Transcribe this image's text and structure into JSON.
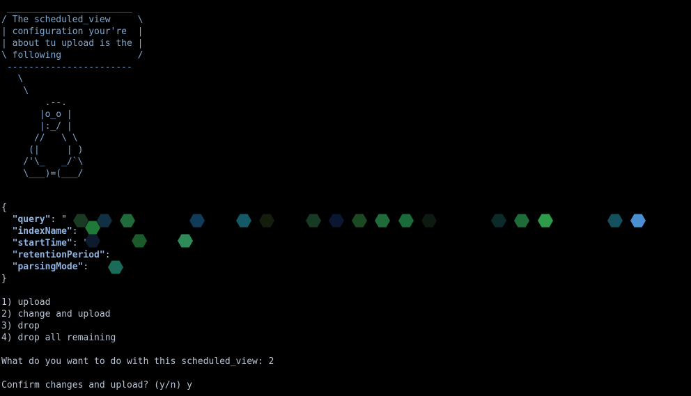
{
  "terminal": {
    "cowsay_bubble": [
      " _______________________",
      "/ The scheduled_view     \\",
      "| configuration your're  |",
      "| about tu upload is the |",
      "\\ following              /",
      " -----------------------"
    ],
    "tux_art": [
      "   \\",
      "    \\",
      "        .--.",
      "       |o_o |",
      "       |:_/ |",
      "      //   \\ \\",
      "     (|     | )",
      "    /'\\_   _/`\\",
      "    \\___)=(___/"
    ],
    "json_block": {
      "open_brace": "{",
      "close_brace": "}",
      "fields": [
        {
          "key": "\"query\"",
          "sep": ": ",
          "value": "\""
        },
        {
          "key": "\"indexName\"",
          "sep": ":",
          "value": ""
        },
        {
          "key": "\"startTime\"",
          "sep": ": ",
          "value": "\""
        },
        {
          "key": "\"retentionPeriod\"",
          "sep": ":",
          "value": ""
        },
        {
          "key": "\"parsingMode\"",
          "sep": ":",
          "value": ""
        }
      ]
    },
    "menu_options": [
      "1) upload",
      "2) change and upload",
      "3) drop",
      "4) drop all remaining"
    ],
    "question_prompt": "What do you want to do with this scheduled_view: ",
    "question_answer": "2",
    "confirm_prompt": "Confirm changes and upload? (y/n) ",
    "confirm_answer": "y"
  },
  "colors": {
    "background": "#000000",
    "text": "#b9c4d2",
    "art": "#7fa7cf",
    "json_key": "#8fb3e0",
    "redaction_palette": [
      "#1f6b3a",
      "#2e8b57",
      "#1a4d3a",
      "#103c5a",
      "#1e5a7a",
      "#4a90d0",
      "#13402a",
      "#0d2a1c"
    ]
  },
  "redaction_marks": [
    {
      "row": "query",
      "color": "#1a3a24"
    },
    {
      "row": "query",
      "color": "#123043"
    },
    {
      "row": "query",
      "color": "#1f6b3a"
    },
    {
      "row": "query",
      "color": "#103c5a"
    },
    {
      "row": "query",
      "color": "#135a66"
    },
    {
      "row": "query",
      "color": "#141d0c"
    },
    {
      "row": "query",
      "color": "#163a24"
    },
    {
      "row": "query",
      "color": "#0b1630"
    },
    {
      "row": "query",
      "color": "#1b4a22"
    },
    {
      "row": "query",
      "color": "#1f6b3a"
    },
    {
      "row": "query",
      "color": "#1a6b3a"
    },
    {
      "row": "query",
      "color": "#0d1a12"
    },
    {
      "row": "query",
      "color": "#0d2a2a"
    },
    {
      "row": "query",
      "color": "#1f6b3a"
    },
    {
      "row": "query",
      "color": "#2e9b4a"
    },
    {
      "row": "query",
      "color": "#14505e"
    },
    {
      "row": "query",
      "color": "#4a90d0"
    },
    {
      "row": "indexName",
      "color": "#1f7a3a"
    },
    {
      "row": "startTime",
      "color": "#0e1a2e"
    },
    {
      "row": "startTime",
      "color": "#1b5a2a"
    },
    {
      "row": "startTime",
      "color": "#2e8b57"
    },
    {
      "row": "parsingMode",
      "color": "#1a6b5a"
    }
  ]
}
